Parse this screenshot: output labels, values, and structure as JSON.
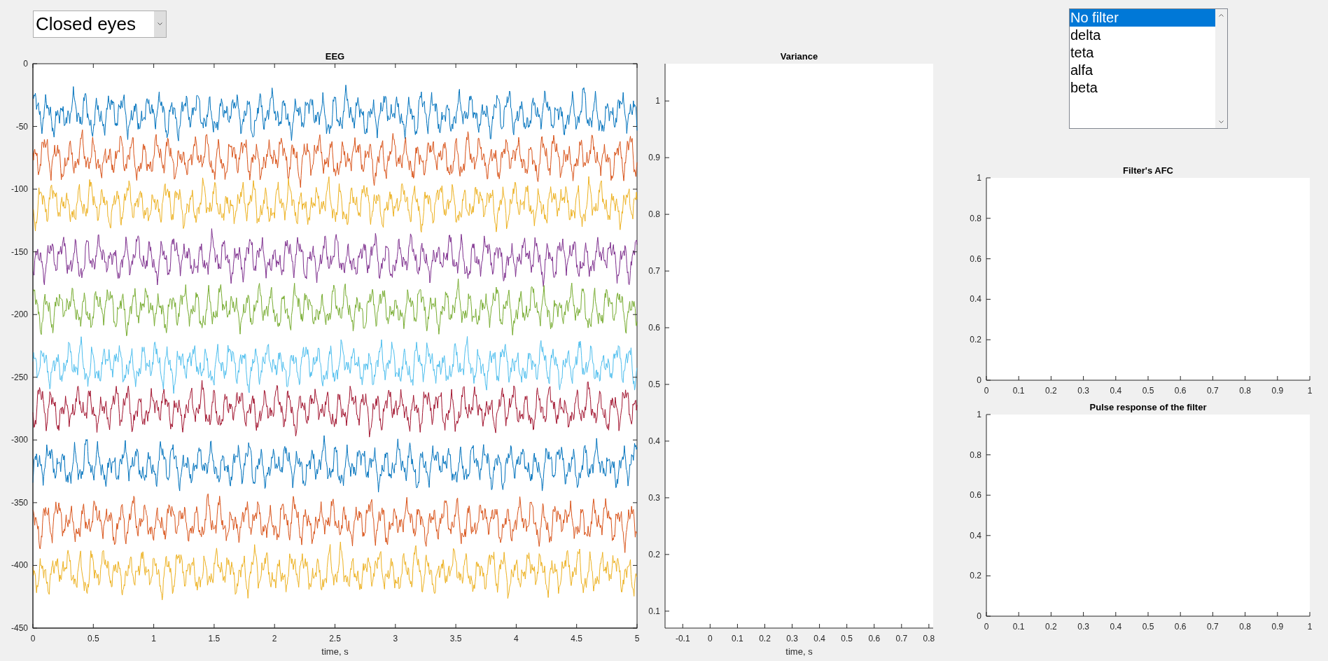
{
  "mode_dropdown": {
    "value": "Closed eyes"
  },
  "filter_list": {
    "items": [
      {
        "label": "No filter",
        "selected": true
      },
      {
        "label": "delta",
        "selected": false
      },
      {
        "label": "teta",
        "selected": false
      },
      {
        "label": "alfa",
        "selected": false
      },
      {
        "label": "beta",
        "selected": false
      }
    ]
  },
  "plots": [
    {
      "kind": "eeg",
      "title": "EEG",
      "xlabel": "time, s",
      "xticks": [
        "0",
        "0.5",
        "1",
        "1.5",
        "2",
        "2.5",
        "3",
        "3.5",
        "4",
        "4.5",
        "5"
      ],
      "yticks": [
        "0",
        "-50",
        "-100",
        "-150",
        "-200",
        "-250",
        "-300",
        "-350",
        "-400",
        "-450"
      ]
    },
    {
      "kind": "empty",
      "title": "Variance",
      "xlabel": "time, s",
      "xticks": [
        "-0.1",
        "0",
        "0.1",
        "0.2",
        "0.3",
        "0.4",
        "0.5",
        "0.6",
        "0.7",
        "0.8"
      ],
      "yticks": [
        "1",
        "0.9",
        "0.8",
        "0.7",
        "0.6",
        "0.5",
        "0.4",
        "0.3",
        "0.2",
        "0.1"
      ]
    },
    {
      "kind": "empty",
      "title": "Filter's AFC",
      "xticks": [
        "0",
        "0.1",
        "0.2",
        "0.3",
        "0.4",
        "0.5",
        "0.6",
        "0.7",
        "0.8",
        "0.9",
        "1"
      ],
      "yticks": [
        "1",
        "0.8",
        "0.6",
        "0.4",
        "0.2",
        "0"
      ]
    },
    {
      "kind": "empty",
      "title": "Pulse response of the filter",
      "xticks": [
        "0",
        "0.1",
        "0.2",
        "0.3",
        "0.4",
        "0.5",
        "0.6",
        "0.7",
        "0.8",
        "0.9",
        "1"
      ],
      "yticks": [
        "1",
        "0.8",
        "0.6",
        "0.4",
        "0.2",
        "0"
      ]
    }
  ]
}
